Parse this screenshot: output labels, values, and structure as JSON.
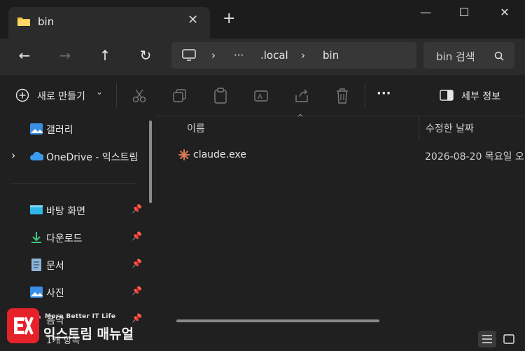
{
  "titlebar": {
    "tab_title": "bin",
    "close_tab_glyph": "✕",
    "new_tab_glyph": "+",
    "minimize_glyph": "—",
    "maximize_glyph": "☐",
    "close_glyph": "✕"
  },
  "nav": {
    "back_glyph": "←",
    "forward_glyph": "→",
    "up_glyph": "↑",
    "refresh_glyph": "↻",
    "breadcrumb": {
      "sep1": "›",
      "ellipsis": "···",
      "folder1": ".local",
      "sep2": "›",
      "folder2": "bin"
    },
    "search_placeholder": "bin 검색"
  },
  "commandbar": {
    "new_label": "새로 만들기",
    "new_chevron": "⌄",
    "more_glyph": "···",
    "details_label": "세부 정보"
  },
  "sidebar": {
    "items": [
      {
        "label": "갤러리",
        "icon": "gallery-icon"
      },
      {
        "label": "OneDrive - 익스트림",
        "icon": "cloud-icon",
        "chevron": "›"
      },
      {
        "label": "바탕 화면",
        "icon": "desktop-icon"
      },
      {
        "label": "다운로드",
        "icon": "download-icon"
      },
      {
        "label": "문서",
        "icon": "document-icon"
      },
      {
        "label": "사진",
        "icon": "pictures-icon"
      },
      {
        "label": "음악",
        "icon": "music-icon"
      }
    ],
    "pin_glyph": "📌"
  },
  "content": {
    "columns": {
      "name": "이름",
      "modified": "수정한 날짜"
    },
    "sort_glyph": "^",
    "files": [
      {
        "name": "claude.exe",
        "modified": "2026-08-20 목요일 오"
      }
    ]
  },
  "statusbar": {
    "item_count": "1개 항목"
  },
  "watermark": {
    "tagline": "More Better IT Life",
    "name": "익스트림 매뉴얼"
  },
  "colors": {
    "accent": "#4cc2ff",
    "folder": "#f5c542",
    "logo_red": "#e5222a"
  }
}
